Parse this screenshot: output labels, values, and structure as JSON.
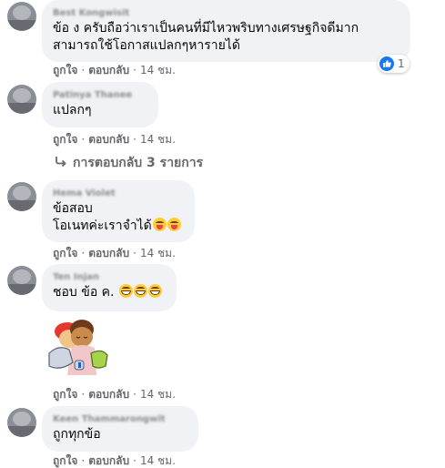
{
  "comments": [
    {
      "name": "Best Kongwisit",
      "text_lines": [
        "ข้อ ง ครับถือว่าเราเป็นคนที่มีไหวพริบทางเศรษฐกิจดีมาก",
        "สามารถใช้โอกาสแปลกๆหารายได้"
      ],
      "like": "ถูกใจ",
      "reply": "ตอบกลับ",
      "time": "14 ชม.",
      "reaction_count": "1"
    },
    {
      "name": "Patinya Thanee",
      "text_lines": [
        "แปลกๆ"
      ],
      "like": "ถูกใจ",
      "reply": "ตอบกลับ",
      "time": "14 ชม.",
      "replies_link": "การตอบกลับ 3 รายการ"
    },
    {
      "name": "Hema Violet",
      "text_lines": [
        "ข้อสอบ",
        "โอเนทค่ะเราจำได้"
      ],
      "like": "ถูกใจ",
      "reply": "ตอบกลับ",
      "time": "14 ชม."
    },
    {
      "name": "Ten Injan",
      "text_lines": [
        "ชอบ ข้อ ค."
      ],
      "like": "ถูกใจ",
      "reply": "ตอบกลับ",
      "time": "14 ชม."
    },
    {
      "name": "Keen Thammarongwit",
      "text_lines": [
        "ถูกทุกข้อ"
      ],
      "like": "ถูกใจ",
      "reply": "ตอบกลับ",
      "time": "14 ชม."
    }
  ],
  "colors": {
    "bubble": "#f0f2f5",
    "meta_text": "#65676b",
    "like_blue": "#1877f2"
  },
  "icons": {
    "reaction": "like-thumb-icon",
    "reply_arrow": "reply-arrow-icon",
    "sticker": "hug-sticker",
    "emoji_tongue": "tongue-out-emoji",
    "emoji_grin": "grinning-emoji"
  }
}
